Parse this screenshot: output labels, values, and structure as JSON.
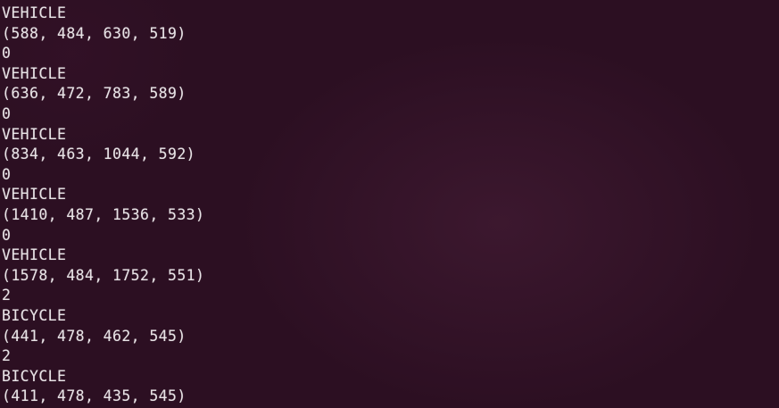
{
  "terminal": {
    "lines": [
      "VEHICLE",
      "(588, 484, 630, 519)",
      "0",
      "VEHICLE",
      "(636, 472, 783, 589)",
      "0",
      "VEHICLE",
      "(834, 463, 1044, 592)",
      "0",
      "VEHICLE",
      "(1410, 487, 1536, 533)",
      "0",
      "VEHICLE",
      "(1578, 484, 1752, 551)",
      "2",
      "BICYCLE",
      "(441, 478, 462, 545)",
      "2",
      "BICYCLE",
      "(411, 478, 435, 545)"
    ]
  },
  "colors": {
    "background": "#2c0f22",
    "text": "#e8e3e6"
  }
}
